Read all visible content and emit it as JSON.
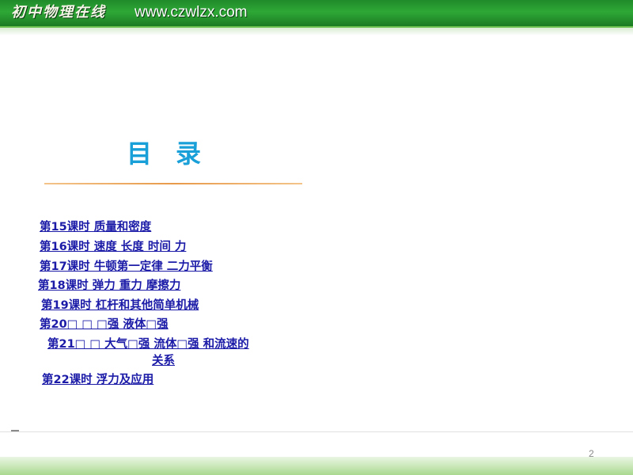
{
  "header": {
    "brand_script": "初中物理在线",
    "url": "www.czwlzx.com"
  },
  "title": "目录",
  "toc": [
    {
      "label": "第15课时 质量和密度"
    },
    {
      "label": "第16课时 速度 长度 时间 力"
    },
    {
      "label": "第17课时 牛顿第一定律 二力平衡"
    },
    {
      "label": "第18课时 弹力 重力 摩擦力"
    },
    {
      "label": "第19课时 杠杆和其他简单机械"
    },
    {
      "label": "第20□ □ □强 液体□强"
    },
    {
      "label": "第21□ □ 大气□强 流体□强 和流速的"
    },
    {
      "label": "关系"
    },
    {
      "label": "第22课时 浮力及应用"
    }
  ],
  "page_number": "2",
  "colors": {
    "banner_green": "#2ea836",
    "title_blue": "#1aa0d8",
    "link_blue": "#1b1ba8",
    "underline_orange": "#e89a4a"
  }
}
